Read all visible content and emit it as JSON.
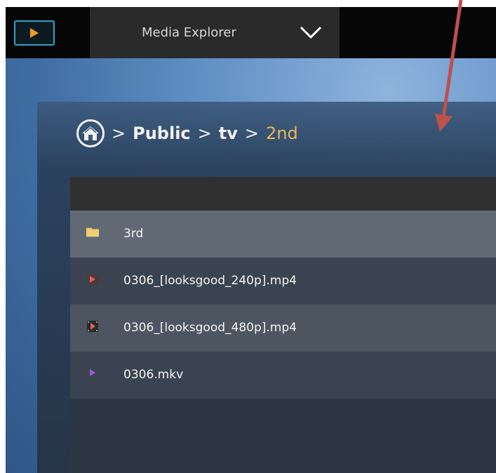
{
  "app": {
    "title": "Media Explorer"
  },
  "breadcrumb": {
    "separator": ">",
    "items": [
      "Public",
      "tv"
    ],
    "current": "2nd"
  },
  "files": [
    {
      "name": "3rd",
      "icon": "folder-icon"
    },
    {
      "name": "0306_[looksgood_240p].mp4",
      "icon": "video-file-icon"
    },
    {
      "name": "0306_[looksgood_480p].mp4",
      "icon": "film-file-icon"
    },
    {
      "name": "0306.mkv",
      "icon": "mkv-file-icon"
    }
  ],
  "colors": {
    "accent": "#2fa2c8",
    "current_crumb": "#e7b85a",
    "annotation_arrow": "#c0504d"
  }
}
